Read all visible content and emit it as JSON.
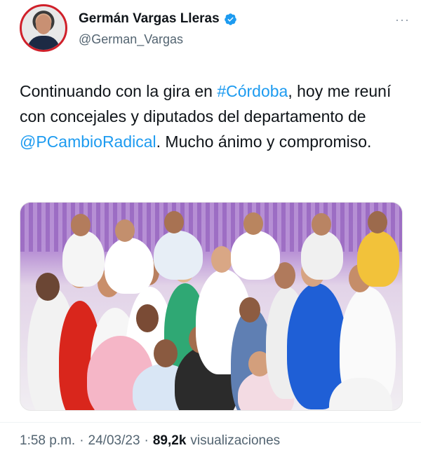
{
  "author": {
    "name": "Germán Vargas Lleras",
    "handle": "@German_Vargas",
    "verified_icon": "verified-badge-icon",
    "more_label": "···"
  },
  "post": {
    "text_parts": [
      {
        "text": "Continuando con la gira en ",
        "type": "text"
      },
      {
        "text": "#Córdoba",
        "type": "link"
      },
      {
        "text": ", hoy me reuní con  concejales y diputados del departamento de ",
        "type": "text"
      },
      {
        "text": "@PCambioRadical",
        "type": "link"
      },
      {
        "text": ". Mucho ánimo y compromiso.",
        "type": "text"
      }
    ]
  },
  "meta": {
    "time": "1:58 p.m.",
    "sep1": "·",
    "date": "24/03/23",
    "sep2": "·",
    "views_count": "89,2k",
    "views_label": "visualizaciones"
  },
  "colors": {
    "link": "#1d9bf0",
    "muted": "#536471",
    "verified": "#1d9bf0"
  }
}
